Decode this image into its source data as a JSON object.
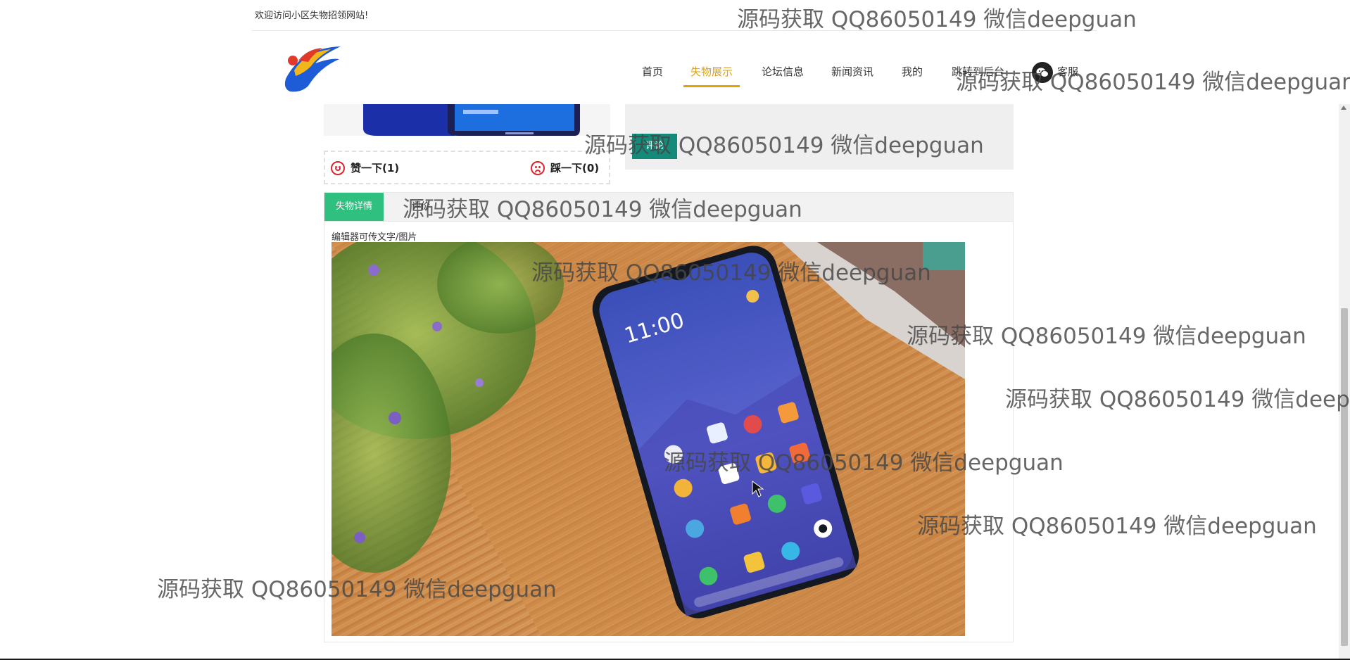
{
  "header": {
    "welcome": "欢迎访问小区失物招领网站!"
  },
  "nav": {
    "items": [
      "首页",
      "失物展示",
      "论坛信息",
      "新闻资讯",
      "我的",
      "跳转到后台",
      "客服"
    ],
    "active_index": 1
  },
  "votes": {
    "like": "赞一下(1)",
    "dislike": "踩一下(0)"
  },
  "comment": {
    "button_label": "评论"
  },
  "detail": {
    "tab_active": "失物详情",
    "tab_second": "评价",
    "editor_note": "编辑器可传文字/图片"
  },
  "watermark": {
    "text": "源码获取 QQ86050149 微信deepguan"
  },
  "colors": {
    "nav_active": "#e5a400",
    "tab_active": "#2fbf7f",
    "comment_button": "#138a7a"
  }
}
